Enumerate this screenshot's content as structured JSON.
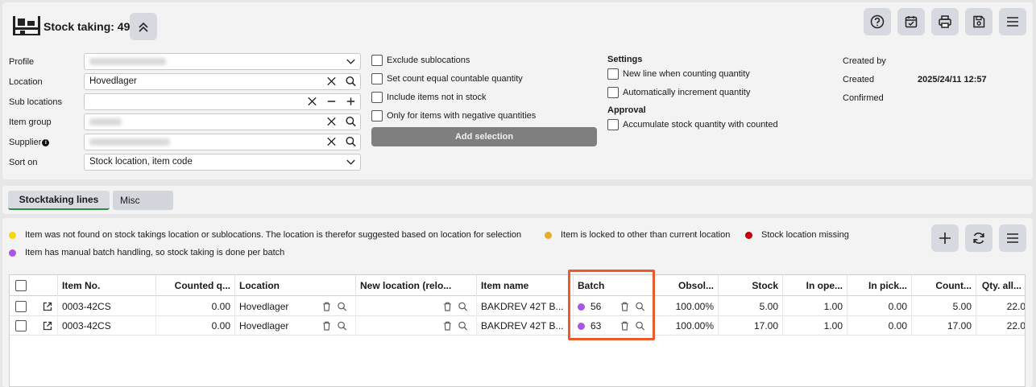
{
  "header": {
    "title": "Stock taking: 49"
  },
  "form": {
    "profile_label": "Profile",
    "location_label": "Location",
    "location_value": "Hovedlager",
    "sublocations_label": "Sub locations",
    "itemgroup_label": "Item group",
    "supplier_label": "Supplier",
    "sorton_label": "Sort on",
    "sorton_value": "Stock location, item code"
  },
  "options": {
    "exclude_sublocations": "Exclude sublocations",
    "set_count_equal": "Set count equal countable quantity",
    "include_not_in_stock": "Include items not in stock",
    "only_negative": "Only for items with negative quantities",
    "add_selection": "Add selection"
  },
  "settings": {
    "title": "Settings",
    "new_line": "New line when counting quantity",
    "auto_increment": "Automatically increment quantity",
    "approval_title": "Approval",
    "accumulate": "Accumulate stock quantity with counted"
  },
  "info": {
    "created_by_label": "Created by",
    "created_label": "Created",
    "created_value": "2025/24/11 12:57",
    "confirmed_label": "Confirmed"
  },
  "tabs": {
    "stocktaking_lines": "Stocktaking lines",
    "misc": "Misc"
  },
  "legend": {
    "yellow_text": "Item was not found on stock takings location or sublocations. The location is therefor suggested based on location for selection",
    "orange_text": "Item is locked to other than current location",
    "red_text": "Stock location missing",
    "purple_text": "Item has manual batch handling, so stock taking is done per batch"
  },
  "colors": {
    "yellow": "#f2d80f",
    "orange": "#e3ad2f",
    "red": "#c5000c",
    "purple": "#a855e8",
    "highlight": "#ea5a2a",
    "tab_underline": "#2e8b3e"
  },
  "table": {
    "columns": {
      "item_no": "Item No.",
      "counted_qty": "Counted q...",
      "location": "Location",
      "new_location": "New location (relo...",
      "item_name": "Item name",
      "batch": "Batch",
      "obsolete": "Obsol...",
      "stock": "Stock",
      "in_operation": "In ope...",
      "in_picking": "In pick...",
      "countable": "Count...",
      "qty_allocated": "Qty. all..."
    },
    "rows": [
      {
        "item_no": "0003-42CS",
        "counted_qty": "0.00",
        "location": "Hovedlager",
        "item_name": "BAKDREV 42T B...",
        "batch": "56",
        "obsolete": "100.00%",
        "stock": "5.00",
        "in_operation": "1.00",
        "in_picking": "0.00",
        "countable": "5.00",
        "qty_allocated": "22.0"
      },
      {
        "item_no": "0003-42CS",
        "counted_qty": "0.00",
        "location": "Hovedlager",
        "item_name": "BAKDREV 42T B...",
        "batch": "63",
        "obsolete": "100.00%",
        "stock": "17.00",
        "in_operation": "1.00",
        "in_picking": "0.00",
        "countable": "17.00",
        "qty_allocated": "22.0"
      }
    ]
  }
}
